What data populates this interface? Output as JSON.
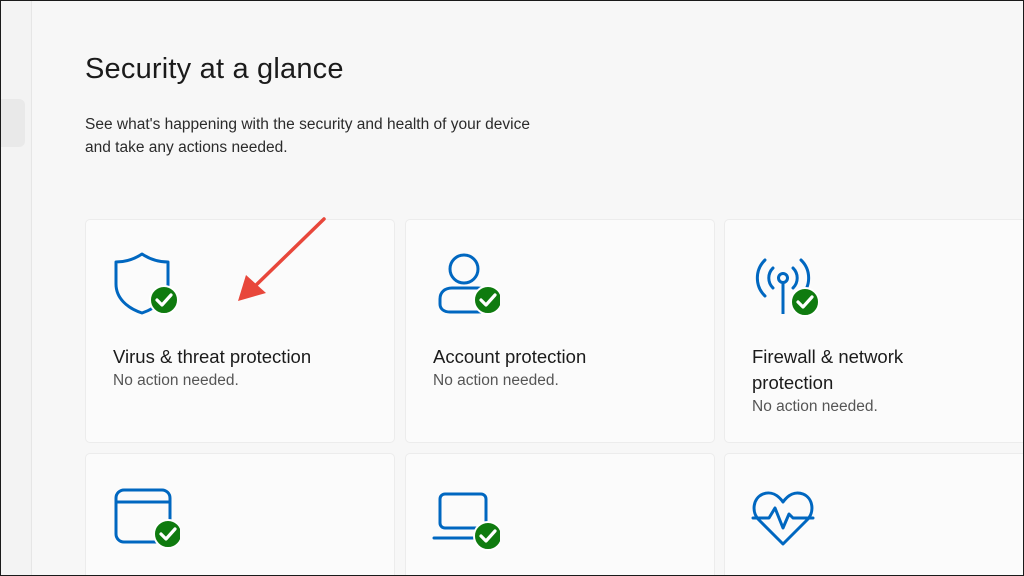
{
  "page": {
    "title": "Security at a glance",
    "description_line1": "See what's happening with the security and health of your device",
    "description_line2": "and take any actions needed."
  },
  "cards": [
    {
      "title": "Virus & threat protection",
      "status": "No action needed.",
      "icon": "shield-icon"
    },
    {
      "title": "Account protection",
      "status": "No action needed.",
      "icon": "person-icon"
    },
    {
      "title_line1": "Firewall & network",
      "title_line2": "protection",
      "status": "No action needed.",
      "icon": "wireless-antenna-icon"
    },
    {
      "icon": "app-browser-window-icon"
    },
    {
      "icon": "laptop-icon"
    },
    {
      "icon": "heart-pulse-icon"
    }
  ],
  "colors": {
    "icon_blue": "#0067c0",
    "check_green": "#0f7b0f",
    "arrow_red": "#e8473b"
  },
  "annotation": {
    "arrow": "red-arrow-pointing-at-virus-card"
  }
}
